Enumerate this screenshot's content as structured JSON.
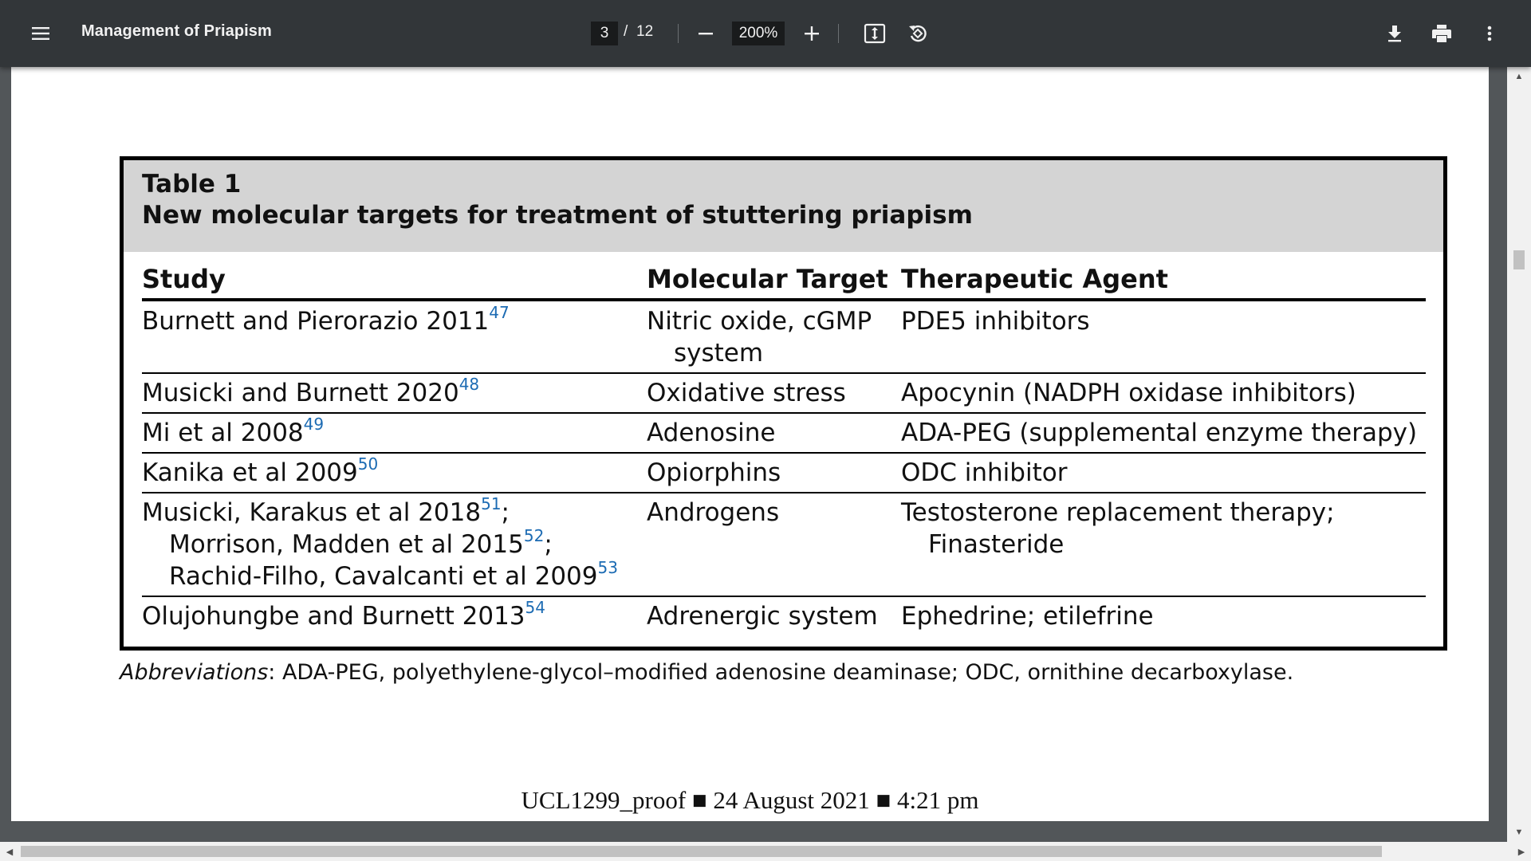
{
  "toolbar": {
    "title": "Management of Priapism",
    "page_current": "3",
    "page_sep": "/",
    "page_total": "12",
    "zoom": "200%",
    "icons": {
      "menu": "menu-icon",
      "zoom_out": "minus-icon",
      "zoom_in": "plus-icon",
      "fit": "fit-page-icon",
      "rotate": "rotate-icon",
      "download": "download-icon",
      "print": "print-icon",
      "more": "more-vert-icon"
    }
  },
  "table": {
    "label": "Table 1",
    "caption": "New molecular targets for treatment of stuttering priapism",
    "headers": {
      "study": "Study",
      "target": "Molecular Target",
      "agent": "Therapeutic Agent"
    },
    "rows": [
      {
        "study": [
          {
            "text": "Burnett and Pierorazio 2011",
            "ref": "47"
          }
        ],
        "target": [
          "Nitric oxide, cGMP",
          "system"
        ],
        "agent": [
          "PDE5 inhibitors"
        ]
      },
      {
        "study": [
          {
            "text": "Musicki and Burnett 2020",
            "ref": "48"
          }
        ],
        "target": [
          "Oxidative stress"
        ],
        "agent": [
          "Apocynin (NADPH oxidase inhibitors)"
        ]
      },
      {
        "study": [
          {
            "text": "Mi et al 2008",
            "ref": "49"
          }
        ],
        "target": [
          "Adenosine"
        ],
        "agent": [
          "ADA-PEG (supplemental enzyme therapy)"
        ]
      },
      {
        "study": [
          {
            "text": "Kanika et al 2009",
            "ref": "50"
          }
        ],
        "target": [
          "Opiorphins"
        ],
        "agent": [
          "ODC inhibitor"
        ]
      },
      {
        "study": [
          {
            "text": "Musicki, Karakus et al 2018",
            "ref": "51",
            "tail": ";"
          },
          {
            "text": "Morrison, Madden et al 2015",
            "ref": "52",
            "tail": ";"
          },
          {
            "text": "Rachid-Filho, Cavalcanti et al 2009",
            "ref": "53"
          }
        ],
        "target": [
          "Androgens"
        ],
        "agent": [
          "Testosterone replacement therapy;",
          "Finasteride"
        ]
      },
      {
        "study": [
          {
            "text": "Olujohungbe and Burnett 2013",
            "ref": "54"
          }
        ],
        "target": [
          "Adrenergic system"
        ],
        "agent": [
          "Ephedrine; etilefrine"
        ]
      }
    ]
  },
  "abbreviations": {
    "label": "Abbreviations",
    "text": ": ADA-PEG, polyethylene-glycol–modified adenosine deaminase; ODC, ornithine decarboxylase."
  },
  "footer": {
    "proof": "UCL1299_proof ■ 24 August 2021 ■ 4:21 pm"
  }
}
